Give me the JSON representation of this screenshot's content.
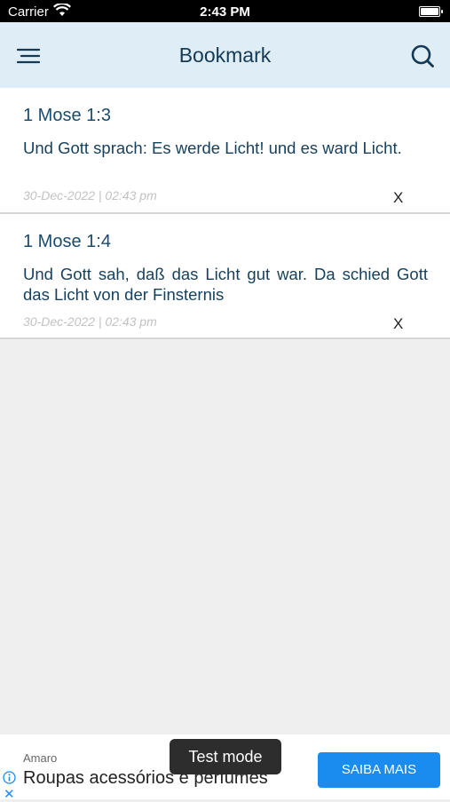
{
  "status_bar": {
    "carrier": "Carrier",
    "time": "2:43 PM"
  },
  "header": {
    "title": "Bookmark"
  },
  "bookmarks": [
    {
      "reference": "1 Mose 1:3",
      "text": "Und Gott sprach: Es werde Licht! und es ward Licht.",
      "date": "30-Dec-2022 | 02:43 pm",
      "remove_label": "X"
    },
    {
      "reference": "1 Mose 1:4",
      "text": "Und Gott sah, daß das Licht gut war. Da schied Gott das Licht von der Finsternis",
      "date": "30-Dec-2022 | 02:43 pm",
      "remove_label": "X"
    }
  ],
  "ad": {
    "advertiser": "Amaro",
    "headline": "Roupas acessórios e perfumes",
    "cta": "SAIBA MAIS",
    "test_badge": "Test mode",
    "close_glyph": "✕"
  },
  "colors": {
    "header_bg": "#dfedf7",
    "accent": "#143954",
    "cta": "#1a8cf0"
  }
}
